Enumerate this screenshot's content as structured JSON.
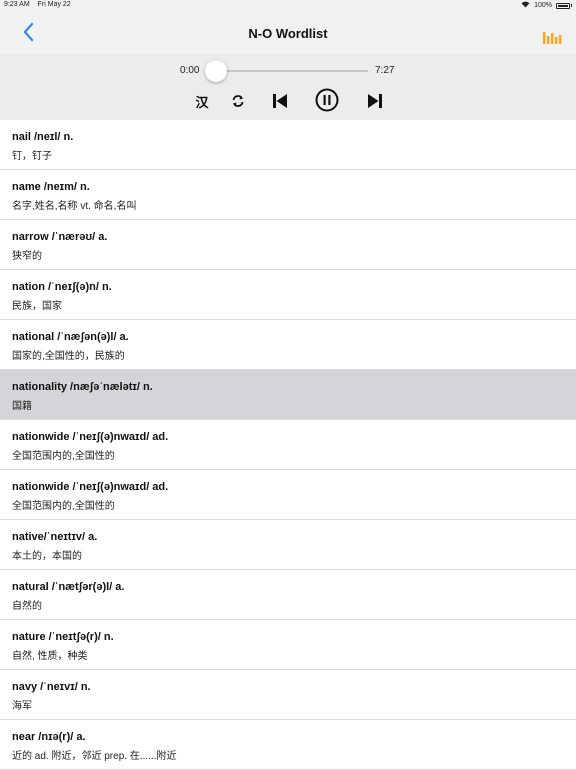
{
  "status_bar": {
    "time": "9:23 AM",
    "date": "Fri May 22",
    "battery_text": "100%"
  },
  "nav": {
    "title": "N-O Wordlist",
    "back_icon": "chevron-left-icon",
    "right_icon": "equalizer-icon"
  },
  "player": {
    "current_time": "0:00",
    "total_time": "7:27",
    "progress": 0.0,
    "han_label": "汉",
    "loop_icon": "repeat-icon",
    "prev_icon": "skip-previous-icon",
    "pause_icon": "pause-circle-icon",
    "next_icon": "skip-next-icon"
  },
  "colors": {
    "accent": "#3b8bd8",
    "equalizer": "#f5a623",
    "selected_row": "#d5d5d9"
  },
  "words": [
    {
      "word": "nail /neɪl/ n.",
      "meaning": "钉，钉子",
      "selected": false
    },
    {
      "word": "name /neɪm/ n.",
      "meaning": "名字,姓名,名称 vt. 命名,名叫",
      "selected": false
    },
    {
      "word": "narrow /ˈnærəʊ/ a.",
      "meaning": "狭窄的",
      "selected": false
    },
    {
      "word": "nation /ˈneɪʃ(ə)n/ n.",
      "meaning": "民族，国家",
      "selected": false
    },
    {
      "word": "national /ˈnæʃən(ə)l/ a.",
      "meaning": "国家的,全国性的，民族的",
      "selected": false
    },
    {
      "word": "nationality /næʃəˈnælətɪ/ n.",
      "meaning": "国籍",
      "selected": true
    },
    {
      "word": "nationwide /ˈneɪʃ(ə)nwaɪd/ ad.",
      "meaning": "全国范围内的,全国性的",
      "selected": false
    },
    {
      "word": "nationwide /ˈneɪʃ(ə)nwaɪd/ ad.",
      "meaning": "全国范围内的,全国性的",
      "selected": false
    },
    {
      "word": "native/ˈneɪtɪv/ a.",
      "meaning": "本土的，本国的",
      "selected": false
    },
    {
      "word": "natural /ˈnætʃər(ə)l/ a.",
      "meaning": "自然的",
      "selected": false
    },
    {
      "word": "nature /ˈneɪtʃə(r)/ n.",
      "meaning": "自然, 性质，种类",
      "selected": false
    },
    {
      "word": "navy /ˈneɪvɪ/ n.",
      "meaning": "海军",
      "selected": false
    },
    {
      "word": "near /nɪə(r)/ a.",
      "meaning": "近的 ad. 附近，邻近 prep. 在......附近",
      "selected": false
    }
  ]
}
